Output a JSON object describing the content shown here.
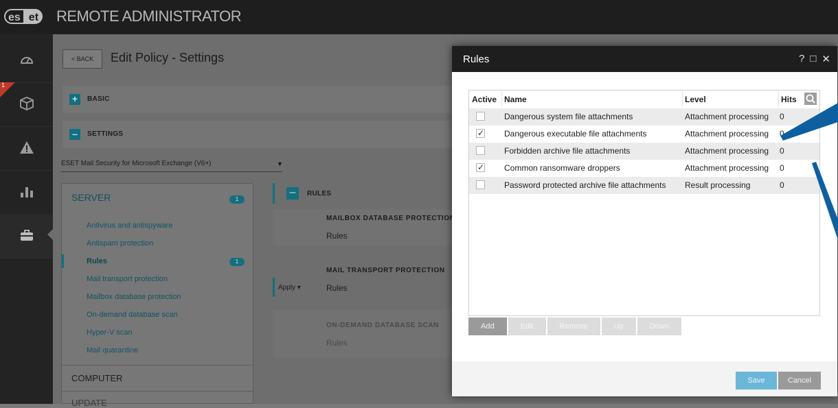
{
  "app": {
    "logo": "eset",
    "title": "REMOTE ADMINISTRATOR"
  },
  "nav": {
    "badge": "1"
  },
  "header": {
    "back_label": "< BACK",
    "page_title": "Edit Policy - Settings"
  },
  "sections": {
    "basic": "BASIC",
    "settings": "SETTINGS"
  },
  "product_select": {
    "value": "ESET Mail Security for Microsoft Exchange (V6+)"
  },
  "panel": {
    "server_label": "SERVER",
    "server_badge": "1",
    "items": [
      {
        "label": "Antivirus and antispyware"
      },
      {
        "label": "Antispam protection"
      },
      {
        "label": "Rules",
        "badge": "1"
      },
      {
        "label": "Mail transport protection"
      },
      {
        "label": "Mailbox database protection"
      },
      {
        "label": "On-demand database scan"
      },
      {
        "label": "Hyper-V scan"
      },
      {
        "label": "Mail quarantine"
      }
    ],
    "computer_label": "COMPUTER",
    "update_label": "UPDATE"
  },
  "rules_area": {
    "header": "RULES",
    "mailbox_db": "MAILBOX DATABASE PROTECTION",
    "mail_transport": "MAIL TRANSPORT PROTECTION",
    "on_demand": "ON-DEMAND DATABASE SCAN",
    "rules_link": "Rules",
    "apply": "Apply"
  },
  "dialog": {
    "title": "Rules",
    "controls": {
      "help": "?",
      "maximize": "□",
      "close": "✕"
    },
    "columns": {
      "active": "Active",
      "name": "Name",
      "level": "Level",
      "hits": "Hits"
    },
    "rows": [
      {
        "active": false,
        "name": "Dangerous system file attachments",
        "level": "Attachment processing",
        "hits": "0"
      },
      {
        "active": true,
        "name": "Dangerous executable file attachments",
        "level": "Attachment processing",
        "hits": "0"
      },
      {
        "active": false,
        "name": "Forbidden archive file attachments",
        "level": "Attachment processing",
        "hits": "0"
      },
      {
        "active": true,
        "name": "Common ransomware droppers",
        "level": "Attachment processing",
        "hits": "0"
      },
      {
        "active": false,
        "name": "Password protected archive file attachments",
        "level": "Result processing",
        "hits": "0"
      }
    ],
    "buttons": {
      "add": "Add",
      "edit": "Edit",
      "remove": "Remove",
      "up": "Up",
      "down": "Down"
    },
    "footer": {
      "save": "Save",
      "cancel": "Cancel"
    }
  },
  "colors": {
    "accent": "#146f80",
    "save_button": "#6cb6d8",
    "callout": "#0d5fa0"
  },
  "icons": [
    "dashboard-icon",
    "computers-icon",
    "threats-icon",
    "reports-icon",
    "admin-icon",
    "search-icon"
  ]
}
